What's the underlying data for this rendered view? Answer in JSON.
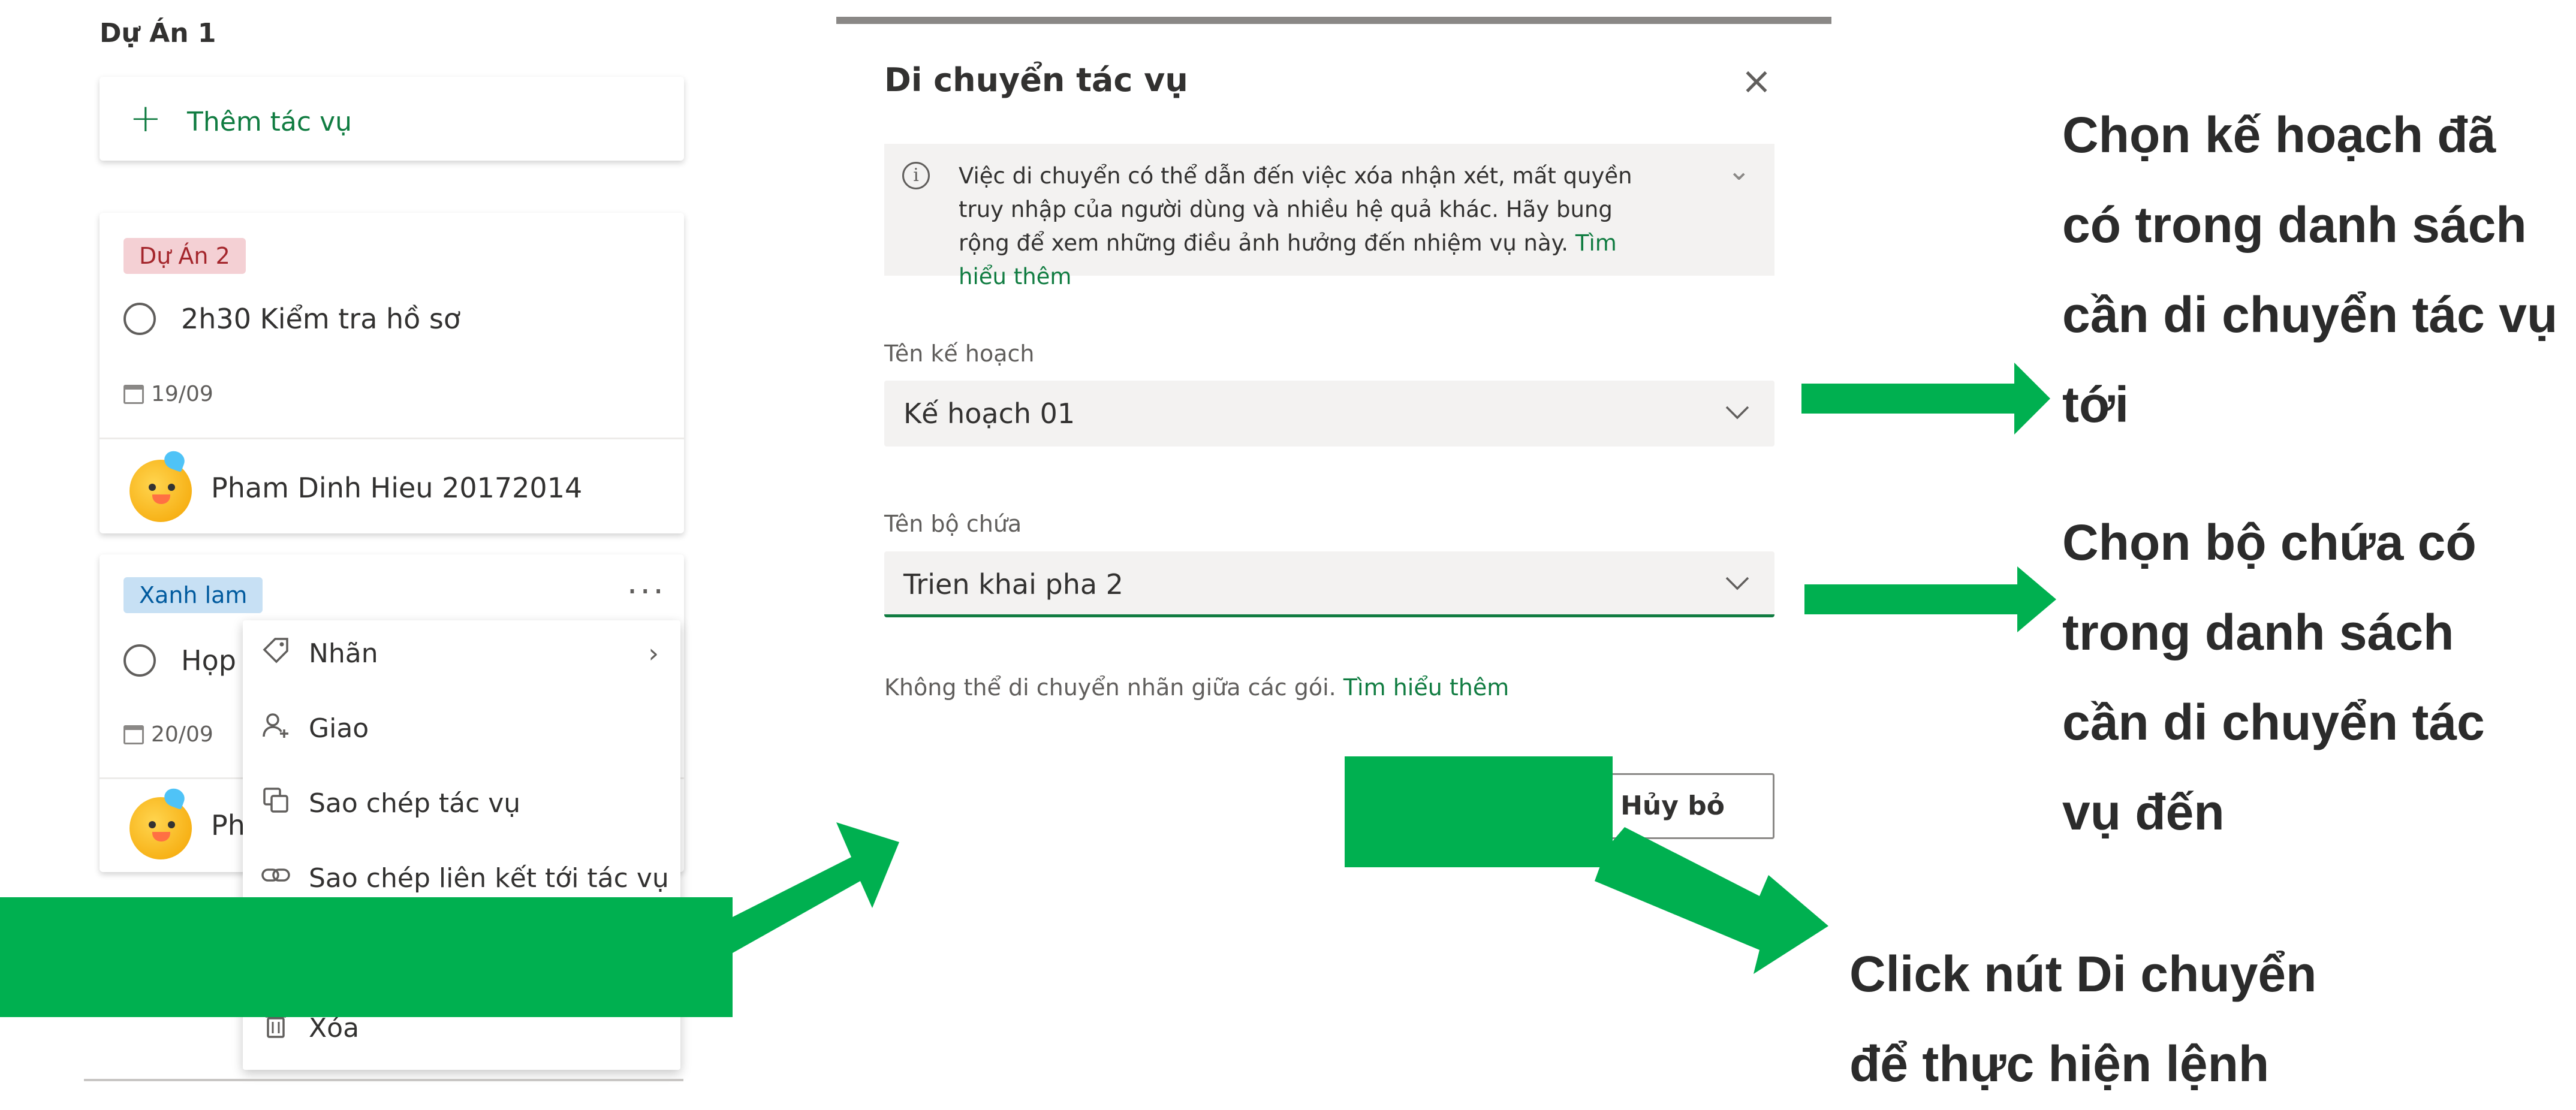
{
  "board": {
    "column_title": "Dự Án 1",
    "add_task_label": "Thêm tác vụ",
    "cards": [
      {
        "label": "Dự Án 2",
        "title": "2h30 Kiểm tra hồ sơ",
        "date": "19/09",
        "assignee": "Pham Dinh Hieu 20172014"
      },
      {
        "label": "Xanh lam",
        "title": "Họp",
        "date": "20/09",
        "assignee": "Ph",
        "more": "···"
      }
    ]
  },
  "context_menu": {
    "items": [
      {
        "label": "Nhãn",
        "icon": "tag-icon",
        "chevron": "›"
      },
      {
        "label": "Giao",
        "icon": "person-add-icon"
      },
      {
        "label": "Sao chép tác vụ",
        "icon": "copy-icon"
      },
      {
        "label": "Sao chép liên kết tới tác vụ",
        "icon": "link-icon"
      },
      {
        "label": "Xóa",
        "icon": "trash-icon"
      }
    ]
  },
  "dialog": {
    "title": "Di chuyển tác vụ",
    "close_glyph": "×",
    "info": {
      "text": "Việc di chuyển có thể dẫn đến việc xóa nhận xét, mất quyền truy nhập của người dùng và nhiều hệ quả khác. Hãy bung rộng để xem những điều ảnh hưởng đến nhiệm vụ này.",
      "link": "Tìm hiểu thêm",
      "expand_glyph": "⌄"
    },
    "plan_field": {
      "label": "Tên kế hoạch",
      "value": "Kế hoạch 01"
    },
    "bucket_field": {
      "label": "Tên bộ chứa",
      "value": "Trien khai pha 2"
    },
    "note": {
      "text": "Không thể di chuyển nhãn giữa các gói.",
      "link": "Tìm hiểu thêm"
    },
    "cancel_label": "Hủy bỏ"
  },
  "annotations": {
    "plan": [
      "Chọn  kế hoạch đã",
      "có trong danh sách",
      "cần di chuyển tác vụ",
      "tới"
    ],
    "bucket": [
      "Chọn bộ chứa có",
      "trong danh sách",
      "cần di chuyển tác",
      "vụ đến"
    ],
    "click": [
      "Click nút Di chuyển",
      "để thực hiện lệnh"
    ]
  },
  "colors": {
    "accent_green": "#107c41",
    "annotation_green": "#00b050"
  }
}
